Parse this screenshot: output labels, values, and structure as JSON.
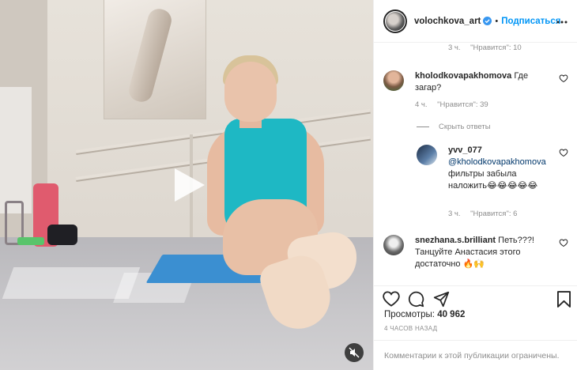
{
  "media": {
    "icons": {
      "play": "play-icon",
      "mute": "muted-speaker-icon"
    }
  },
  "header": {
    "username": "volochkova_art",
    "dot": "•",
    "follow_label": "Подписаться",
    "icons": {
      "verified": "verified-badge-icon",
      "more": "more-options-icon"
    }
  },
  "comments": {
    "top_meta": {
      "time": "3 ч.",
      "likes": "\"Нравится\": 10"
    },
    "items": [
      {
        "username": "kholodkovapakhomova",
        "text": "Где загар?",
        "time": "4 ч.",
        "likes": "\"Нравится\": 39"
      }
    ],
    "hide_replies": "Скрыть ответы",
    "reply": {
      "username": "yvv_077",
      "mention": "@kholodkovapakhomova",
      "text": "фильтры забыла наложить😂😂😂😂😂",
      "time": "3 ч.",
      "likes": "\"Нравится\": 6"
    },
    "last": {
      "username": "snezhana.s.brilliant",
      "text": "Петь???! Танцуйте Анастасия этого достаточно 🔥🙌"
    }
  },
  "actions": {
    "icons": {
      "like": "heart-icon",
      "comment": "comment-icon",
      "share": "share-icon",
      "save": "bookmark-icon"
    }
  },
  "stats": {
    "views_label": "Просмотры:",
    "views_value": "40 962",
    "posted": "4 ЧАСОВ НАЗАД"
  },
  "comments_closed": "Комментарии к этой публикации ограничены.",
  "colors": {
    "accent": "#0095f6",
    "text": "#262626",
    "muted": "#8e8e8e",
    "swimsuit": "#1eb8c4",
    "mat": "#3b8fd1"
  }
}
